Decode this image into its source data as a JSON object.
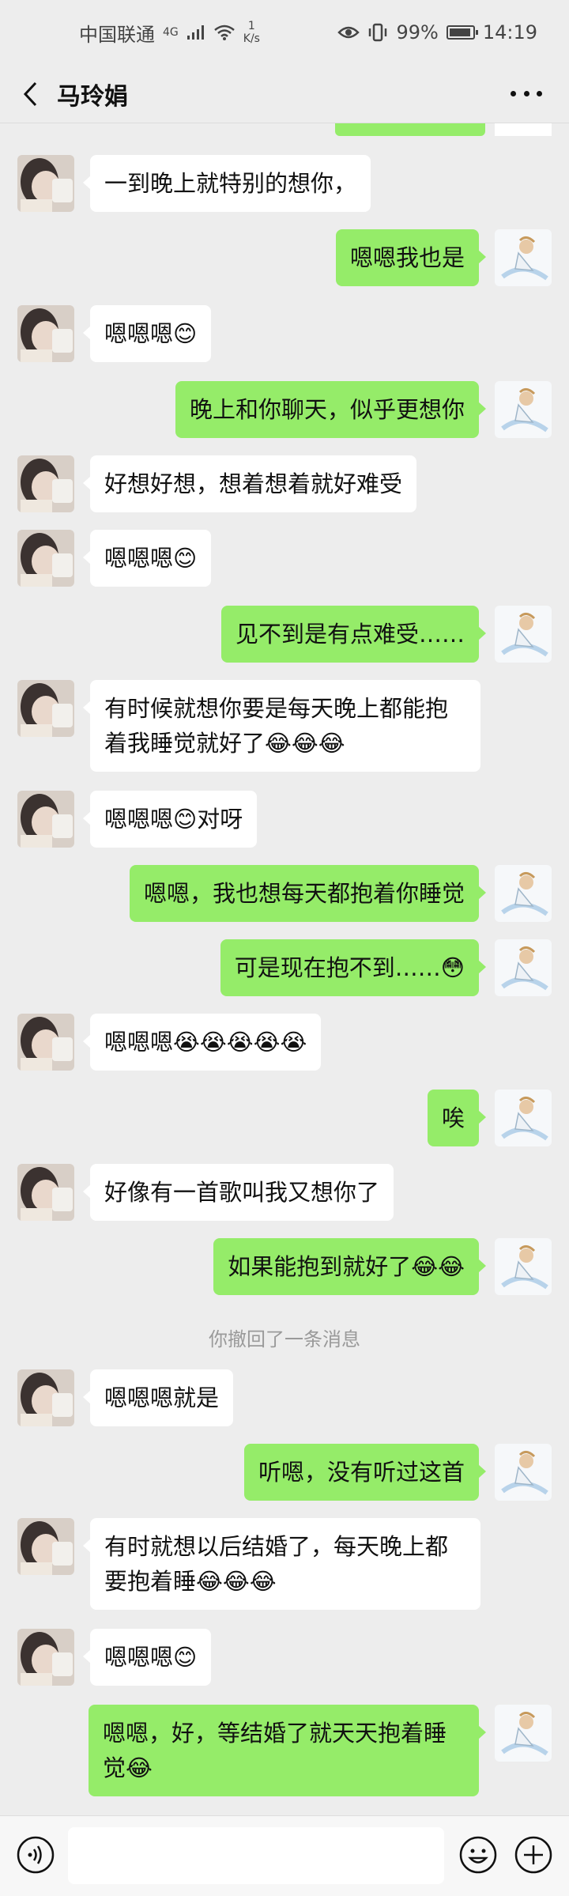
{
  "status_bar": {
    "carrier": "中国联通",
    "network": "4G",
    "speed_value": "1",
    "speed_unit": "K/s",
    "battery": "99%",
    "time": "14:19"
  },
  "header": {
    "title": "马玲娟"
  },
  "messages": [
    {
      "side": "left",
      "text": "一到晚上就特别的想你，"
    },
    {
      "side": "right",
      "text": "嗯嗯我也是"
    },
    {
      "side": "left",
      "text": "嗯嗯嗯😊"
    },
    {
      "side": "right",
      "text": "晚上和你聊天，似乎更想你"
    },
    {
      "side": "left",
      "text": "好想好想，想着想着就好难受"
    },
    {
      "side": "left",
      "text": "嗯嗯嗯😊"
    },
    {
      "side": "right",
      "text": "见不到是有点难受……"
    },
    {
      "side": "left",
      "text": "有时候就想你要是每天晚上都能抱\n着我睡觉就好了😂😂😂"
    },
    {
      "side": "left",
      "text": "嗯嗯嗯😊对呀"
    },
    {
      "side": "right",
      "text": "嗯嗯，我也想每天都抱着你睡觉"
    },
    {
      "side": "right",
      "text": "可是现在抱不到……😳"
    },
    {
      "side": "left",
      "text": "嗯嗯嗯😭😭😭😭😭"
    },
    {
      "side": "right",
      "text": "唉"
    },
    {
      "side": "left",
      "text": "好像有一首歌叫我又想你了"
    },
    {
      "side": "right",
      "text": "如果能抱到就好了😂😂"
    },
    {
      "side": "system",
      "text": "你撤回了一条消息"
    },
    {
      "side": "left",
      "text": "嗯嗯嗯就是"
    },
    {
      "side": "right",
      "text": "听嗯，没有听过这首"
    },
    {
      "side": "left",
      "text": "有时就想以后结婚了，每天晚上都\n要抱着睡😂😂😂"
    },
    {
      "side": "left",
      "text": "嗯嗯嗯😊"
    },
    {
      "side": "right",
      "text": "嗯嗯，好，等结婚了就天天抱着睡\n觉😂"
    }
  ],
  "input_bar": {
    "placeholder": ""
  },
  "colors": {
    "background": "#ededed",
    "sent_bubble": "#95ec69",
    "received_bubble": "#ffffff"
  }
}
